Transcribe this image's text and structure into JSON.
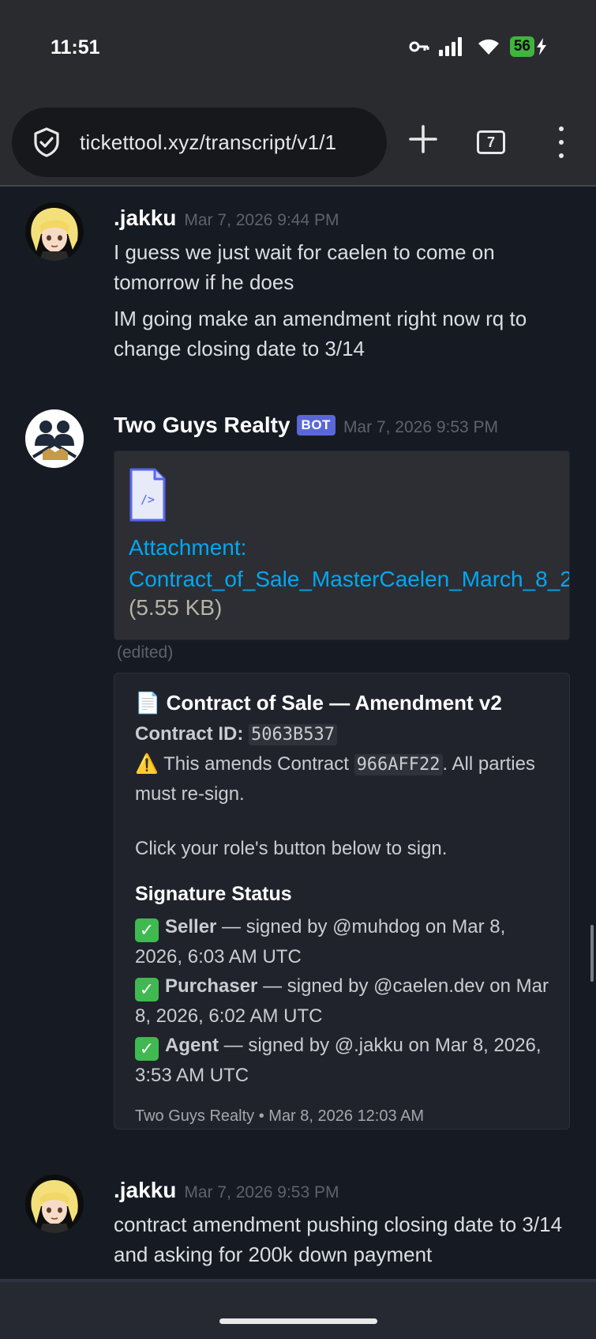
{
  "status_bar": {
    "time": "11:51",
    "battery": "56"
  },
  "browser": {
    "url": "tickettool.xyz/transcript/v1/1",
    "tab_count": "7"
  },
  "messages": [
    {
      "author": ".jakku",
      "timestamp": "Mar 7, 2026 9:44 PM",
      "lines": [
        "I guess we just wait for caelen to come on tomorrow if he does",
        "IM going make an amendment right now rq to change closing date to 3/14"
      ]
    },
    {
      "author": "Two Guys Realty",
      "badge": "BOT",
      "timestamp": "Mar 7, 2026 9:53 PM",
      "attachment": {
        "label": "Attachment:",
        "filename": "Contract_of_Sale_MasterCaelen_March_8_2",
        "size": "(5.55 KB)"
      },
      "edited": "(edited)",
      "embed": {
        "title_icon": "📄",
        "title": "Contract of Sale — Amendment v2",
        "contract_id_label": "Contract ID:",
        "contract_id": "5063B537",
        "warning_icon": "⚠️",
        "warning_prefix": "This amends Contract",
        "amended_contract": "966AFF22",
        "warning_suffix": ". All parties must re-sign.",
        "instruction": "Click your role's button below to sign.",
        "signature_heading": "Signature Status",
        "signatures": [
          {
            "role": "Seller",
            "detail": " — signed by @muhdog on Mar 8, 2026, 6:03 AM UTC"
          },
          {
            "role": "Purchaser",
            "detail": " — signed by @caelen.dev on Mar 8, 2026, 6:02 AM UTC"
          },
          {
            "role": "Agent",
            "detail": " — signed by @.jakku on Mar 8, 2026, 3:53 AM UTC"
          }
        ],
        "check_icon": "✓",
        "footer": "Two Guys Realty • Mar 8, 2026 12:03 AM"
      }
    },
    {
      "author": ".jakku",
      "timestamp": "Mar 7, 2026 9:53 PM",
      "lines": [
        "contract amendment pushing closing date to 3/14 and asking for 200k down payment"
      ]
    }
  ],
  "colors": {
    "link": "#00a8f3",
    "bot_badge": "#5a67d8",
    "check": "#3fb950",
    "background": "#161a23"
  }
}
